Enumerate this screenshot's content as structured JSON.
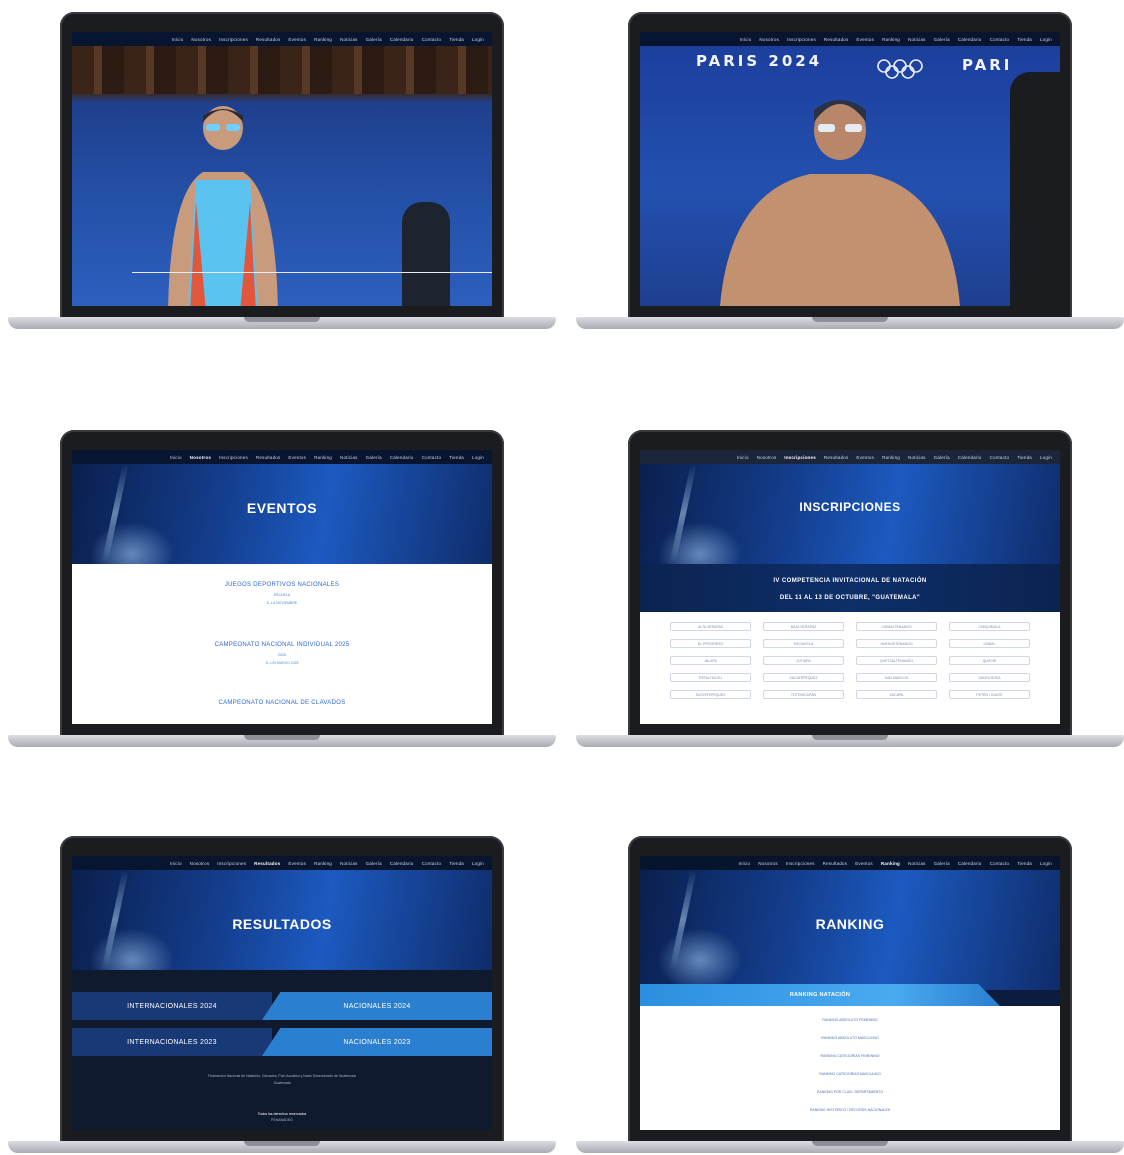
{
  "nav": {
    "items": [
      "Inicio",
      "Nosotros",
      "Inscripciones",
      "Resultados",
      "Eventos",
      "Ranking",
      "Noticias",
      "Galería",
      "Calendario",
      "Contacto",
      "Tienda",
      "Login"
    ]
  },
  "screens": {
    "photo1": {
      "caption": ""
    },
    "photo2": {
      "banner_left": "PARIS 2024",
      "banner_right": "PARI"
    },
    "eventos": {
      "title": "EVENTOS",
      "events": [
        {
          "title": "JUEGOS DEPORTIVOS NACIONALES",
          "sub": "ESCUELA",
          "date": "D.1-6 NOVIEMBRE"
        },
        {
          "title": "CAMPEONATO NACIONAL INDIVIDUAL 2025",
          "sub": "2025",
          "date": "D.1-25 MARZO 2025"
        },
        {
          "title": "CAMPEONATO NACIONAL DE CLAVADOS",
          "sub": "",
          "date": ""
        }
      ]
    },
    "inscripciones": {
      "title": "INSCRIPCIONES",
      "band_line1": "IV COMPETENCIA INVITACIONAL DE NATACIÓN",
      "band_line2": "DEL 11 AL 13 DE OCTUBRE, \"GUATEMALA\"",
      "cells": [
        "ALTA VERAPAZ",
        "BAJA VERAPAZ",
        "CHIMALTENANGO",
        "CHIQUIMULA",
        "EL PROGRESO",
        "ESCUINTLA",
        "HUEHUETENANGO",
        "IZABAL",
        "JALAPA",
        "JUTIAPA",
        "QUETZALTENANGO",
        "QUICHÉ",
        "RETALHULEU",
        "SACATEPÉQUEZ",
        "SAN MARCOS",
        "SANTA ROSA",
        "SUCHITEPÉQUEZ",
        "TOTONICAPÁN",
        "ZACAPA",
        "PETÉN / GUATE"
      ]
    },
    "resultados": {
      "title": "RESULTADOS",
      "left": [
        "INTERNACIONALES 2024",
        "INTERNACIONALES 2023"
      ],
      "right": [
        "NACIONALES 2024",
        "NACIONALES 2023"
      ],
      "footer_line1": "Federación Nacional de Natación, Clavados, Polo Acuático y Nado Sincronizado de Guatemala",
      "footer_line2": "Guatemala",
      "footer_line3": "Todos los derechos reservados",
      "footer_line4": "FENANADEG"
    },
    "ranking": {
      "title": "RANKING",
      "bar_label": "RANKING NATACIÓN",
      "items": [
        "RANKING ABSOLUTO FEMENINO",
        "RANKING ABSOLUTO MASCULINO",
        "RANKING CATEGORÍAS FEMENINO",
        "RANKING CATEGORÍAS MASCULINO",
        "RANKING POR CLUB / DEPARTAMENTO",
        "RANKING HISTÓRICO / RÉCORDS NACIONALES"
      ]
    }
  },
  "colors": {
    "bezel": "#1b1c1f",
    "hero_blue": "#143d8c",
    "accent_blue": "#2a7fd0",
    "link_blue": "#2a66d8"
  }
}
